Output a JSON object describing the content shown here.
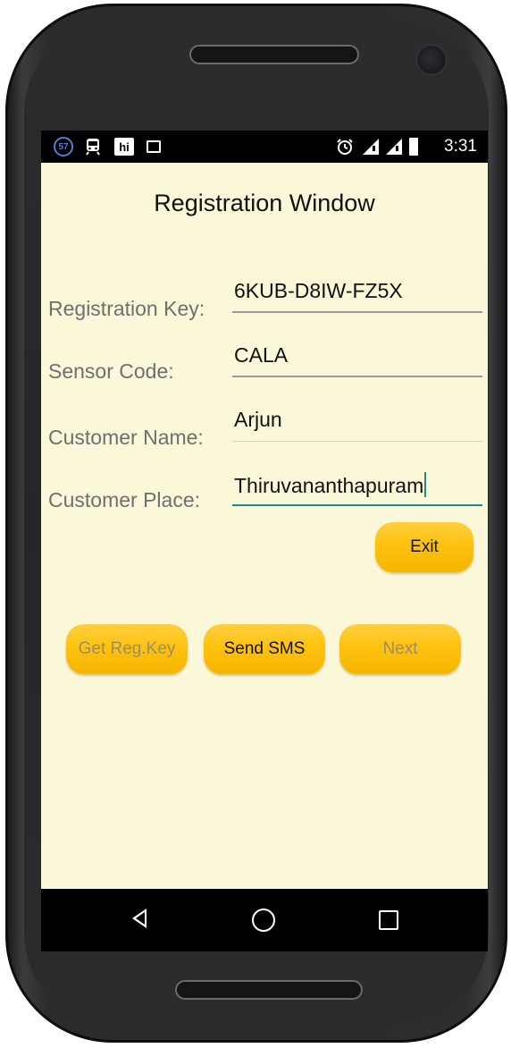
{
  "statusbar": {
    "notification_count": "57",
    "time": "3:31",
    "icons": [
      "notification-count-icon",
      "train-icon",
      "hi-app-icon",
      "image-icon",
      "alarm-icon",
      "signal-icon",
      "signal-icon",
      "battery-icon"
    ]
  },
  "app": {
    "title": "Registration Window",
    "background": "#faf8d8",
    "accent": "#ffc20f",
    "focus_color": "#1c8c85"
  },
  "form": {
    "registration_key_label": "Registration Key:",
    "registration_key_value": "6KUB-D8IW-FZ5X",
    "sensor_code_label": "Sensor Code:",
    "sensor_code_value": "CALA",
    "customer_name_label": "Customer Name:",
    "customer_name_value": "Arjun",
    "customer_place_label": "Customer Place:",
    "customer_place_value": "Thiruvananthapuram"
  },
  "buttons": {
    "exit": "Exit",
    "get_reg_key": "Get Reg.Key",
    "send_sms": "Send SMS",
    "next": "Next"
  },
  "navbar": {
    "icons": [
      "back-icon",
      "home-icon",
      "recent-apps-icon"
    ]
  }
}
